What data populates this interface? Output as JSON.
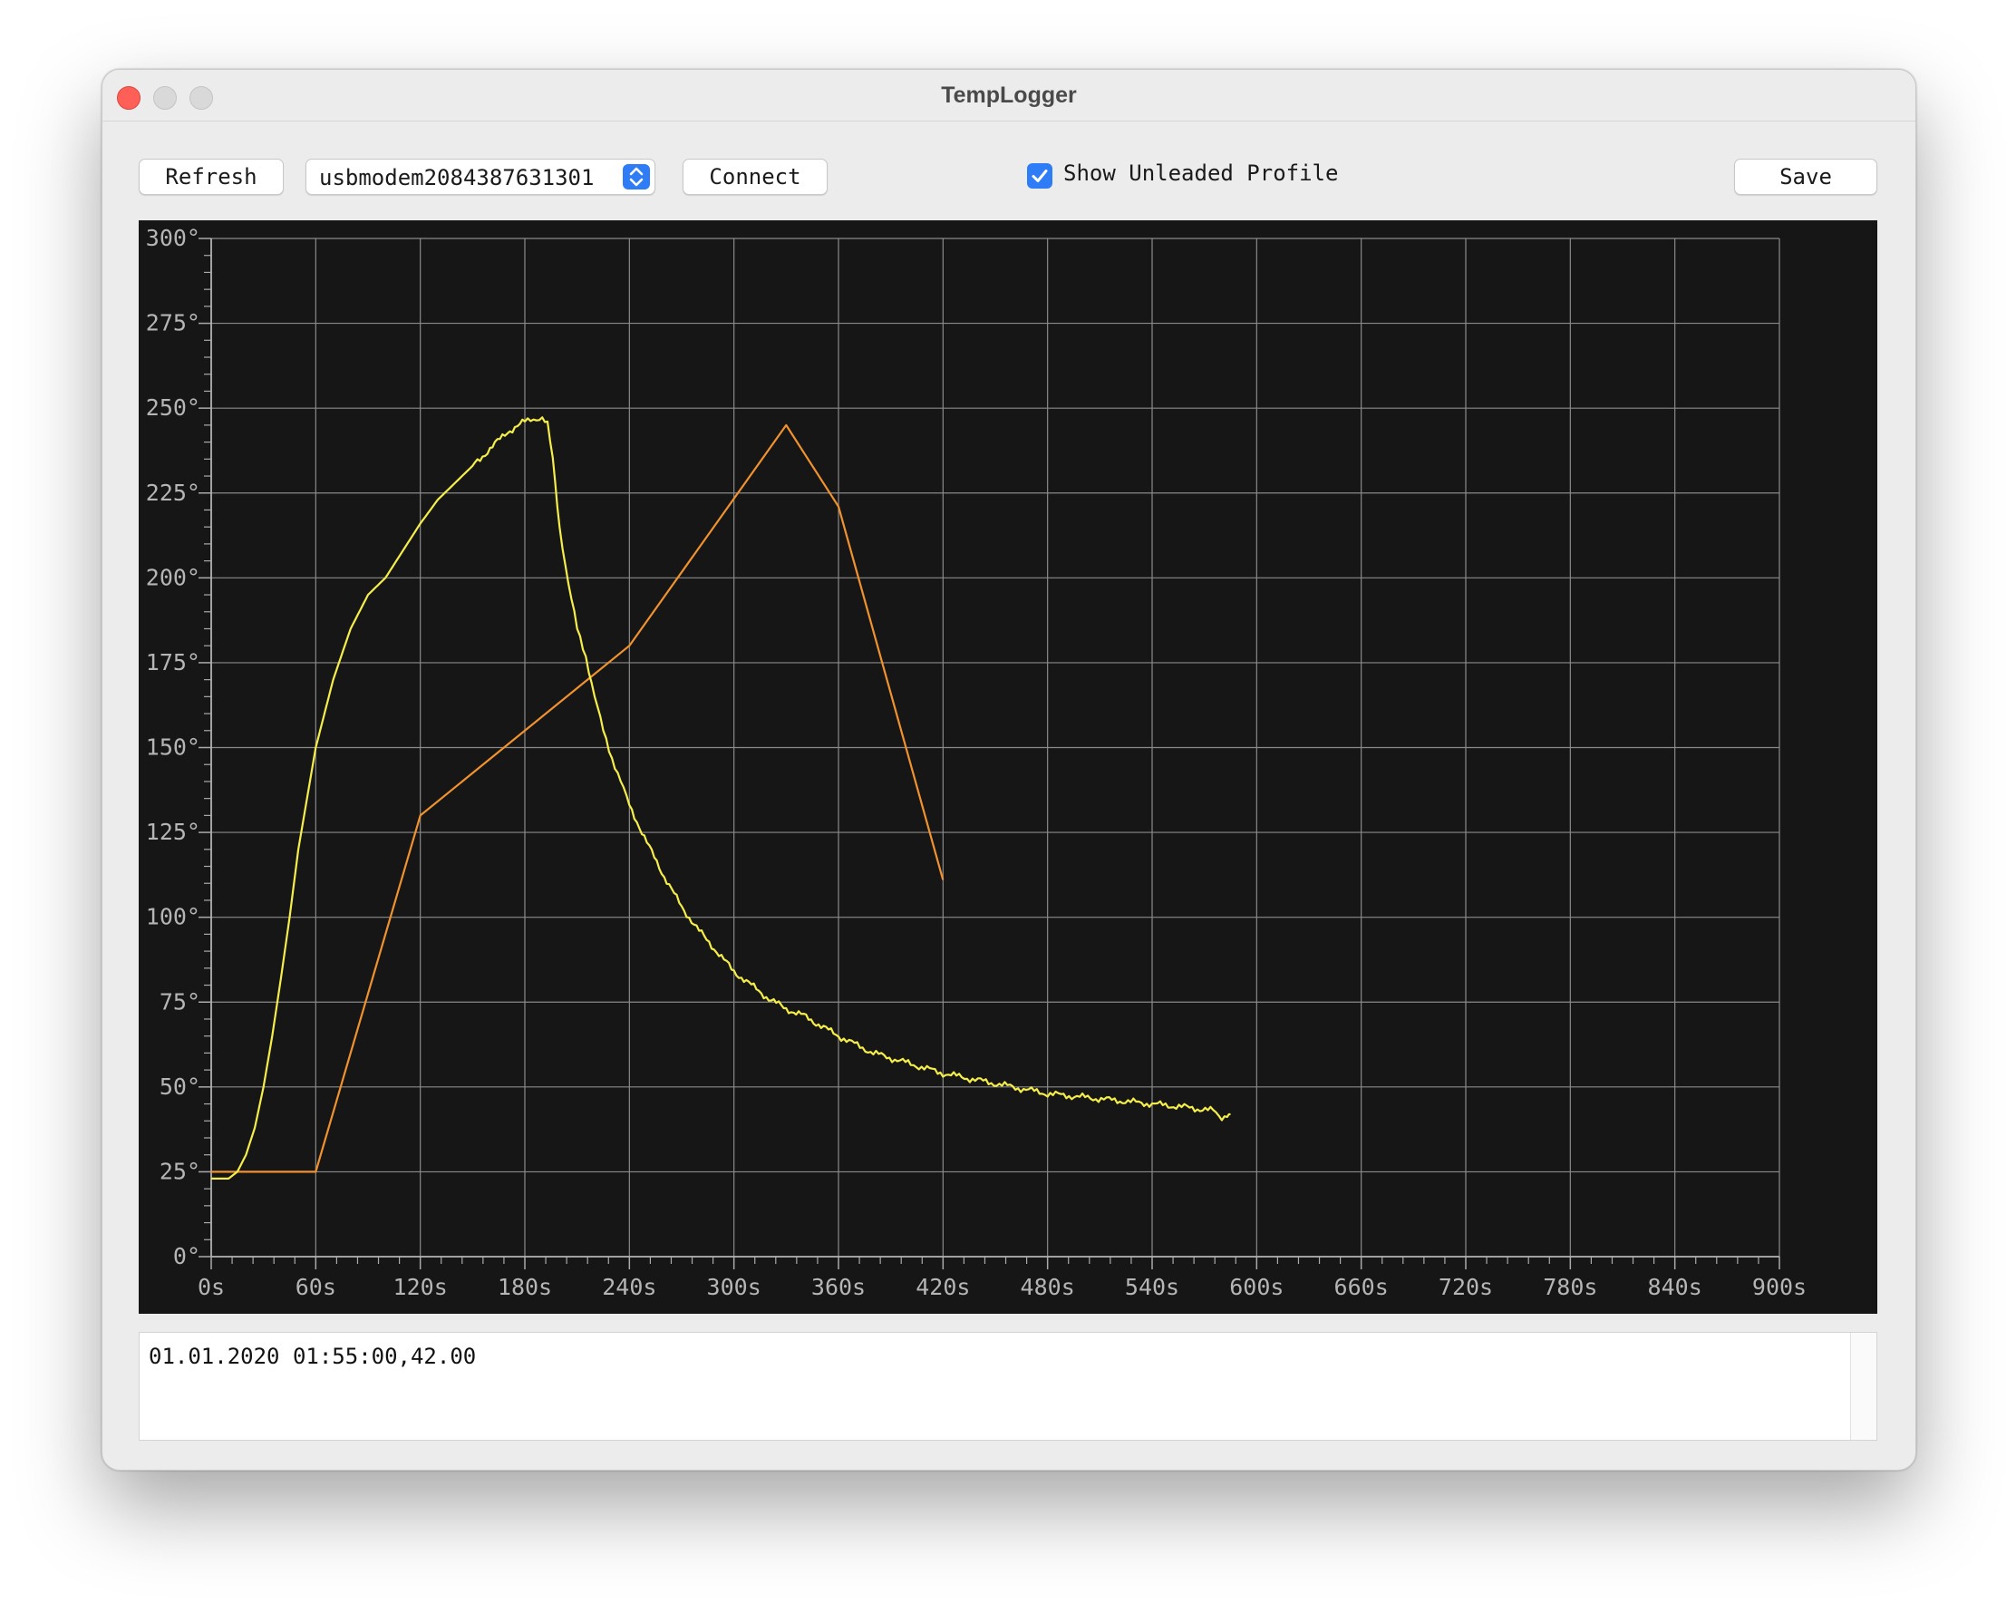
{
  "window": {
    "title": "TempLogger"
  },
  "toolbar": {
    "refresh_label": "Refresh",
    "port_selected": "usbmodem2084387631301",
    "connect_label": "Connect",
    "show_profile_label": "Show Unleaded Profile",
    "show_profile_checked": true,
    "save_label": "Save"
  },
  "log": {
    "text": "01.01.2020 01:55:00,42.00"
  },
  "chart_data": {
    "type": "line",
    "xlabel": "",
    "ylabel": "",
    "xlim": [
      0,
      900
    ],
    "ylim": [
      0,
      300
    ],
    "x_ticks": [
      "0s",
      "60s",
      "120s",
      "180s",
      "240s",
      "300s",
      "360s",
      "420s",
      "480s",
      "540s",
      "600s",
      "660s",
      "720s",
      "780s",
      "840s",
      "900s"
    ],
    "y_ticks": [
      "0°",
      "25°",
      "50°",
      "75°",
      "100°",
      "125°",
      "150°",
      "175°",
      "200°",
      "225°",
      "250°",
      "275°",
      "300°"
    ],
    "grid": true,
    "background": "#161616",
    "series": [
      {
        "color": "#f0922e",
        "x": [
          0,
          60,
          120,
          240,
          330,
          360,
          420
        ],
        "y": [
          25,
          25,
          130,
          180,
          245,
          221,
          111
        ]
      },
      {
        "color": "#f5ee4a",
        "x": [
          0,
          10,
          15,
          20,
          25,
          30,
          35,
          40,
          45,
          50,
          55,
          60,
          70,
          80,
          90,
          100,
          110,
          120,
          130,
          140,
          150,
          160,
          170,
          180,
          185,
          190,
          193,
          196,
          200,
          205,
          210,
          215,
          220,
          225,
          230,
          235,
          240,
          250,
          260,
          270,
          280,
          290,
          300,
          310,
          320,
          330,
          340,
          350,
          360,
          380,
          400,
          420,
          440,
          460,
          480,
          500,
          520,
          540,
          560,
          575,
          580,
          583,
          585
        ],
        "y": [
          23,
          23,
          25,
          30,
          38,
          50,
          65,
          82,
          100,
          120,
          135,
          150,
          170,
          185,
          195,
          200,
          208,
          216,
          223,
          228,
          233,
          238,
          243,
          246,
          247,
          247,
          245,
          235,
          215,
          198,
          185,
          177,
          165,
          155,
          147,
          140,
          133,
          122,
          112,
          103,
          96,
          90,
          84,
          80,
          76,
          73,
          71,
          68,
          65,
          60,
          57,
          54,
          52,
          50,
          48,
          47,
          46,
          45,
          44,
          43,
          41,
          42,
          42
        ]
      }
    ]
  }
}
